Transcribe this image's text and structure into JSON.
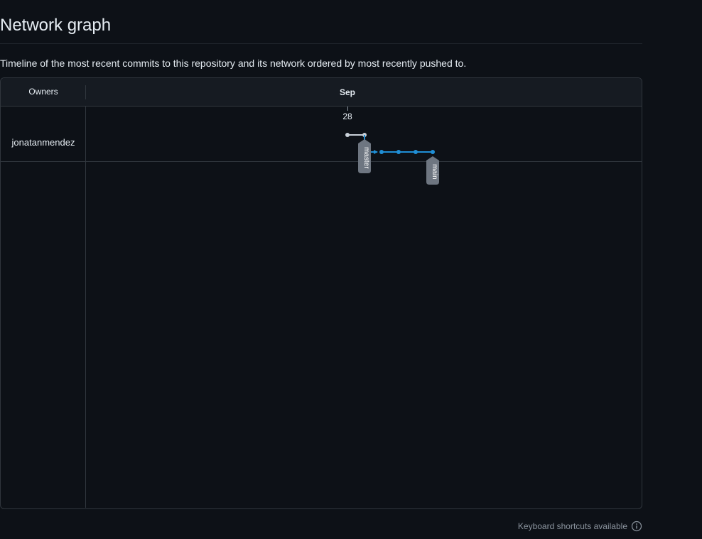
{
  "page": {
    "title": "Network graph",
    "description": "Timeline of the most recent commits to this repository and its network ordered by most recently pushed to."
  },
  "graph": {
    "owners_header": "Owners",
    "month": "Sep",
    "day": "28",
    "owners": [
      "jonatanmendez"
    ],
    "branches": [
      {
        "name": "master",
        "color": "#e6edf3"
      },
      {
        "name": "main",
        "color": "#1f8fd6"
      }
    ],
    "colors": {
      "master_line": "#c9d1d9",
      "main_line": "#1f8fd6",
      "label_bg": "#6e7681"
    }
  },
  "footer": {
    "shortcuts_label": "Keyboard shortcuts available",
    "shortcuts_icon": "info-icon"
  }
}
